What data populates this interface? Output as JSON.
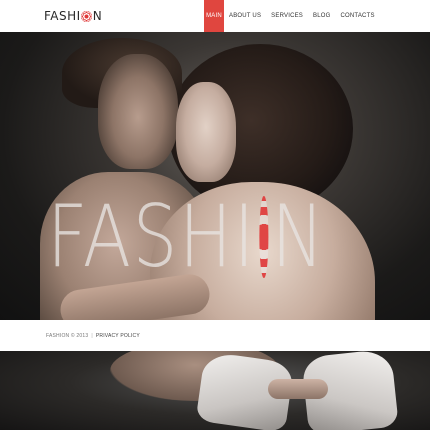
{
  "header": {
    "logo_prefix": "FASHI",
    "logo_suffix": "N",
    "logo_o_icon": "target-icon"
  },
  "nav": {
    "items": [
      {
        "label": "MAIN",
        "active": true
      },
      {
        "label": "ABOUT US",
        "active": false
      },
      {
        "label": "SERVICES",
        "active": false
      },
      {
        "label": "BLOG",
        "active": false
      },
      {
        "label": "CONTACTS",
        "active": false
      }
    ]
  },
  "hero": {
    "word_prefix": "FASHI",
    "word_suffix": "N"
  },
  "footer": {
    "copyright": "FASHION © 2013",
    "separator": "|",
    "privacy_link": "PRIVACY POLICY"
  },
  "colors": {
    "accent": "#e0463f",
    "header_bg": "#ffffff",
    "text_dark": "#2a2a2a"
  }
}
